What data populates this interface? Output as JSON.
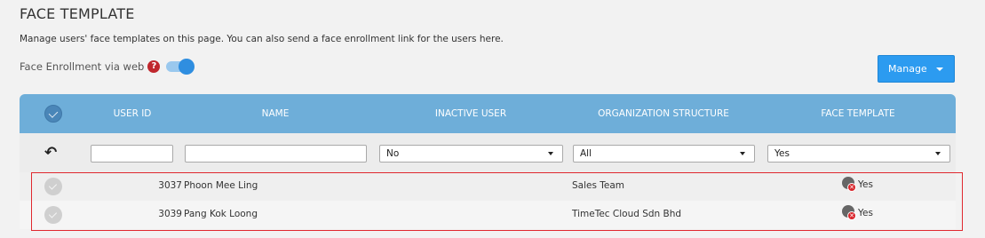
{
  "page": {
    "title": "FACE TEMPLATE",
    "description": "Manage users' face templates on this page. You can also send a face enrollment link for the users here.",
    "enrollment_label": "Face Enrollment via web",
    "help_glyph": "?",
    "enrollment_enabled": true,
    "manage_label": "Manage"
  },
  "table": {
    "columns": [
      "USER ID",
      "NAME",
      "INACTIVE USER",
      "ORGANIZATION STRUCTURE",
      "FACE TEMPLATE"
    ],
    "filters": {
      "user_id": "",
      "name": "",
      "inactive_user": "No",
      "organization_structure": "All",
      "face_template": "Yes"
    },
    "rows": [
      {
        "user_id": "3037",
        "name": "Phoon Mee Ling",
        "organization": "Sales Team",
        "face_template": "Yes"
      },
      {
        "user_id": "3039",
        "name": "Pang Kok Loong",
        "organization": "TimeTec Cloud Sdn Bhd",
        "face_template": "Yes"
      }
    ]
  },
  "colors": {
    "header_bg": "#6eaed9",
    "manage_button": "#2c9bf0",
    "highlight_border": "#e0292f",
    "help_icon": "#c0272d"
  },
  "icons": {
    "help": "question-circle-icon",
    "undo": "undo-icon",
    "check": "check-circle-icon",
    "face": "face-template-icon",
    "dropdown": "caret-down-icon"
  }
}
